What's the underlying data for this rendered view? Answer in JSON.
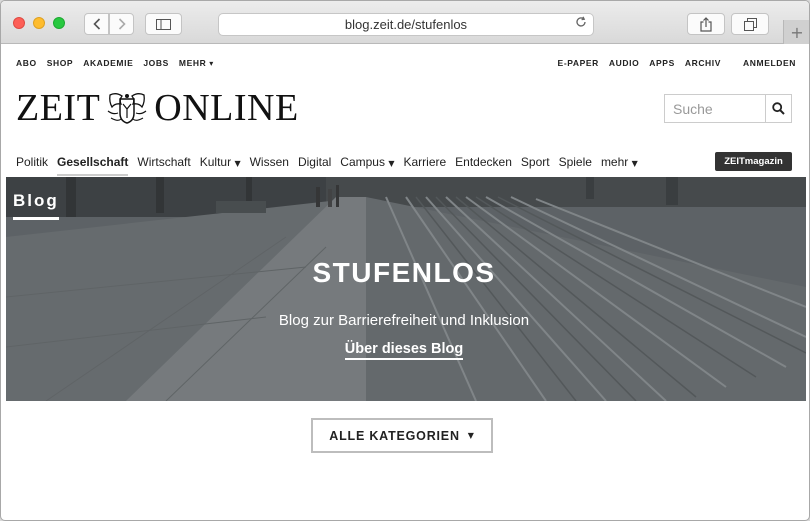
{
  "browser": {
    "url": "blog.zeit.de/stufenlos",
    "back_icon": "chevron-left-icon",
    "forward_icon": "chevron-right-icon",
    "reload_icon": "reload-icon",
    "plus": "+"
  },
  "utility_nav": {
    "left": [
      "ABO",
      "SHOP",
      "AKADEMIE",
      "JOBS",
      "MEHR"
    ],
    "right": [
      "E-PAPER",
      "AUDIO",
      "APPS",
      "ARCHIV"
    ],
    "login": "ANMELDEN"
  },
  "logo": {
    "left": "ZEIT",
    "right": "ONLINE"
  },
  "search": {
    "placeholder": "Suche"
  },
  "main_nav": {
    "items": [
      "Politik",
      "Gesellschaft",
      "Wirtschaft",
      "Kultur",
      "Wissen",
      "Digital",
      "Campus",
      "Karriere",
      "Entdecken",
      "Sport",
      "Spiele",
      "mehr"
    ],
    "active": "Gesellschaft",
    "zeitmagazin": "ZEITmagazin"
  },
  "hero": {
    "tag": "Blog",
    "title": "STUFENLOS",
    "subtitle": "Blog zur Barrierefreiheit und Inklusion",
    "link": "Über dieses Blog"
  },
  "categories_button": "ALLE KATEGORIEN",
  "colors": {
    "zeitmagazin_bg": "#333333",
    "hero_overlay": "#5d6467"
  }
}
